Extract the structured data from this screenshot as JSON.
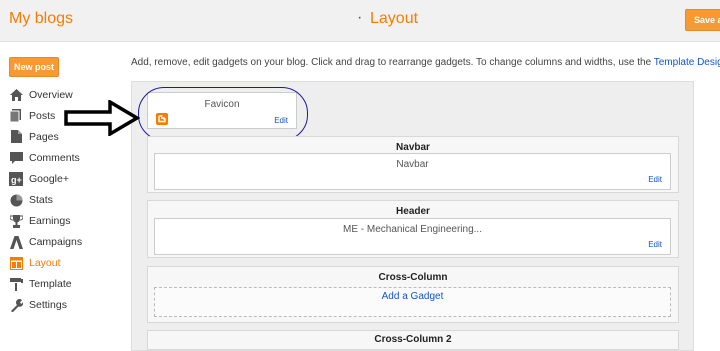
{
  "header": {
    "brand": "My blogs",
    "separator": "·",
    "page_title": "Layout",
    "save_label": "Save arrangement",
    "accent": "#f57d00"
  },
  "sidebar": {
    "new_post_label": "New post",
    "items": [
      {
        "label": "Overview",
        "icon": "home-icon"
      },
      {
        "label": "Posts",
        "icon": "posts-icon"
      },
      {
        "label": "Pages",
        "icon": "pages-icon"
      },
      {
        "label": "Comments",
        "icon": "comments-icon"
      },
      {
        "label": "Google+",
        "icon": "google-plus-icon"
      },
      {
        "label": "Stats",
        "icon": "stats-icon"
      },
      {
        "label": "Earnings",
        "icon": "trophy-icon"
      },
      {
        "label": "Campaigns",
        "icon": "campaigns-icon"
      },
      {
        "label": "Layout",
        "icon": "layout-icon",
        "active": true
      },
      {
        "label": "Template",
        "icon": "template-icon"
      },
      {
        "label": "Settings",
        "icon": "wrench-icon"
      }
    ]
  },
  "main": {
    "description": "Add, remove, edit gadgets on your blog. Click and drag to rearrange gadgets. To change columns and widths, use the ",
    "template_designer_link": "Template Designer",
    "description_end": ".",
    "favicon": {
      "title": "Favicon",
      "edit": "Edit"
    },
    "sections": [
      {
        "title": "Navbar",
        "gadget_title": "Navbar",
        "edit": "Edit"
      },
      {
        "title": "Header",
        "gadget_title": "ME - Mechanical Engineering...",
        "edit": "Edit"
      },
      {
        "title": "Cross-Column",
        "add_gadget": "Add a Gadget"
      },
      {
        "title": "Cross-Column 2"
      }
    ]
  }
}
